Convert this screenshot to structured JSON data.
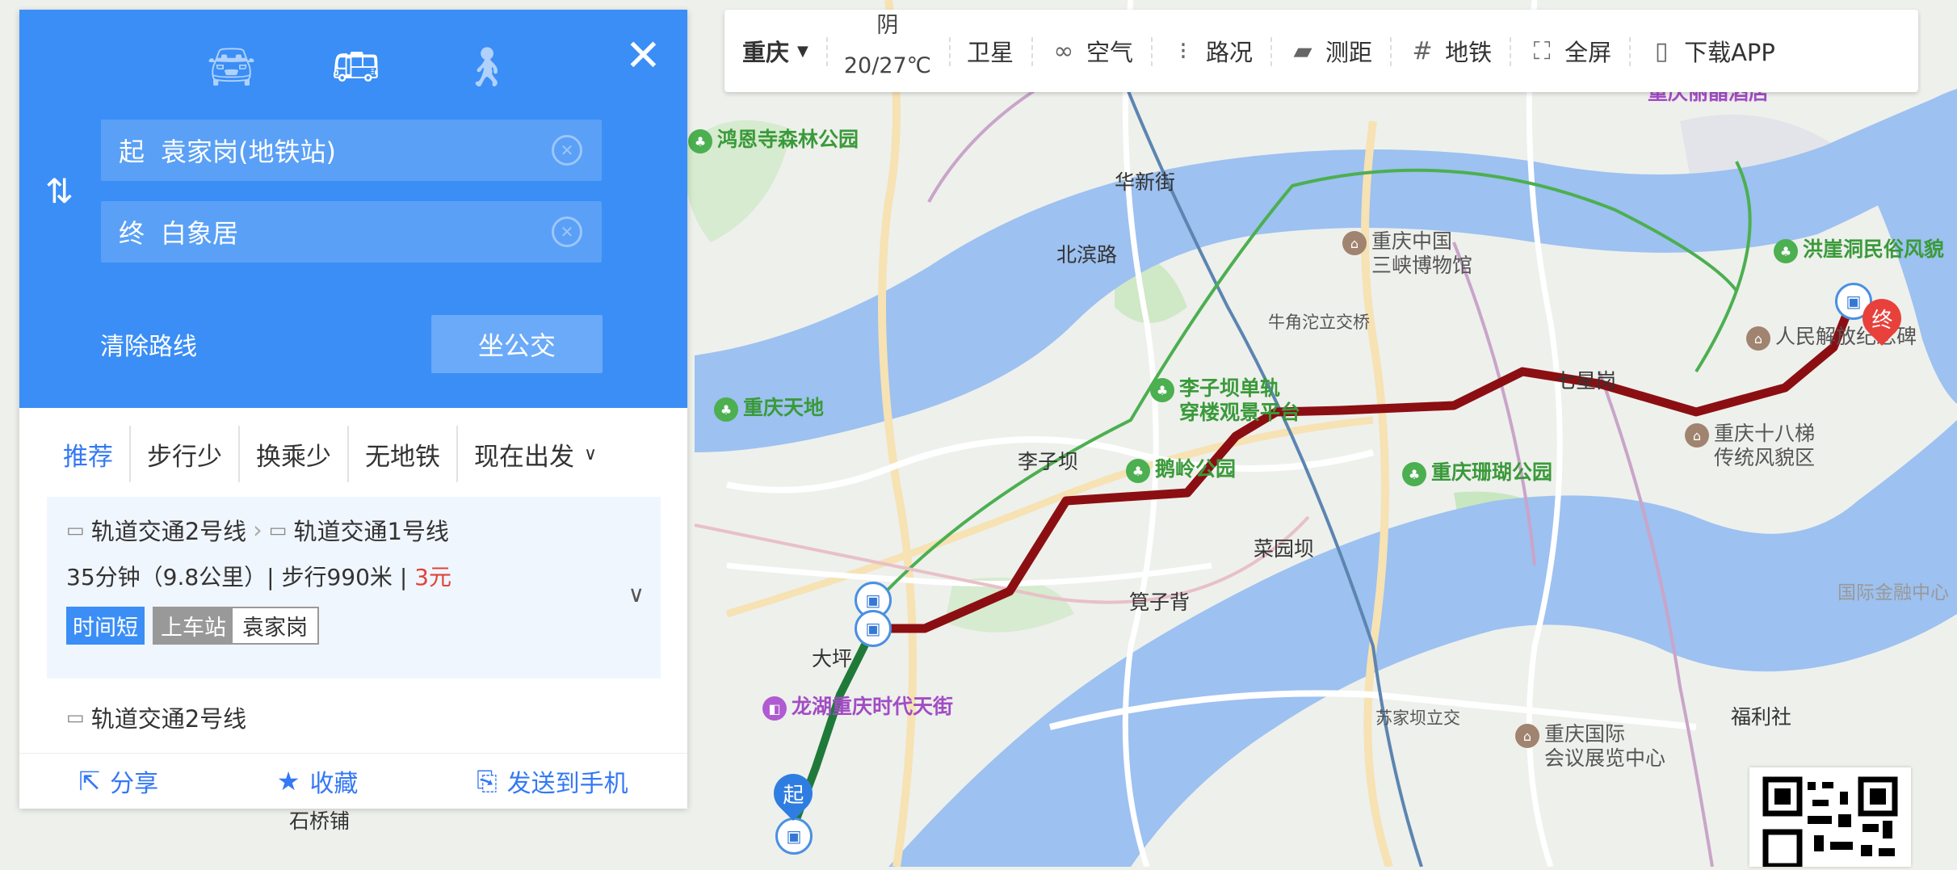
{
  "toolbar": {
    "city": "重庆",
    "weather_condition": "阴",
    "weather_temp": "20/27℃",
    "items": [
      {
        "label": "卫星",
        "icon": "satellite-icon"
      },
      {
        "label": "空气",
        "icon": "air-quality-icon"
      },
      {
        "label": "路况",
        "icon": "traffic-light-icon"
      },
      {
        "label": "测距",
        "icon": "ruler-icon"
      },
      {
        "label": "地铁",
        "icon": "subway-icon"
      },
      {
        "label": "全屏",
        "icon": "fullscreen-icon"
      },
      {
        "label": "下载APP",
        "icon": "phone-icon"
      }
    ]
  },
  "panel": {
    "modes": [
      "car-icon",
      "bus-icon",
      "walk-icon"
    ],
    "start_tag": "起",
    "start_value": "袁家岗(地铁站)",
    "end_tag": "终",
    "end_value": "白象居",
    "clear_route": "清除路线",
    "search_button": "坐公交",
    "filters": [
      "推荐",
      "步行少",
      "换乘少",
      "无地铁",
      "现在出发"
    ],
    "routes": [
      {
        "line1": "轨道交通2号线",
        "line2": "轨道交通1号线",
        "meta": "35分钟（9.8公里）| 步行990米 | ",
        "price": "3元",
        "tag_main": "时间短",
        "tag_label": "上车站",
        "tag_value": "袁家岗"
      },
      {
        "line1": "轨道交通2号线"
      }
    ],
    "footer": {
      "share": "分享",
      "favorite": "收藏",
      "send": "发送到手机"
    }
  },
  "map": {
    "start_marker": "起",
    "end_marker": "终",
    "route_color": "#8b0f12",
    "walk_color": "#1f7a3a",
    "labels": {
      "huaxinjie": "华新街",
      "beibinlu": "北滨路",
      "niujiaotuo": "牛角沱立交桥",
      "lizi": "李子坝",
      "qixinggang": "七星岗",
      "caiyuanba": "菜园坝",
      "kuanzibei": "筧子背",
      "daping": "大坪",
      "suijiaba": "苏家坝立交",
      "fulishe": "福利社",
      "shiqiaopu": "石桥铺",
      "gjjr": "国际金融中心"
    },
    "pois": {
      "hongensi": "鸿恩寺森林公园",
      "sanxia_1": "重庆中国",
      "sanxia_2": "三峡博物馆",
      "hongyadong": "洪崖洞民俗风貌",
      "jiefangbei": "人民解放纪念碑",
      "tiandi": "重庆天地",
      "lzb_1": "李子坝单轨",
      "lzb_2": "穿楼观景平台",
      "eling": "鹅岭公园",
      "shanhu": "重庆珊瑚公园",
      "shibati_1": "重庆十八梯",
      "shibati_2": "传统风貌区",
      "longhu": "龙湖重庆时代天街",
      "guoji_1": "重庆国际",
      "guoji_2": "会议展览中心",
      "hotel": "重庆丽晶酒店"
    }
  }
}
